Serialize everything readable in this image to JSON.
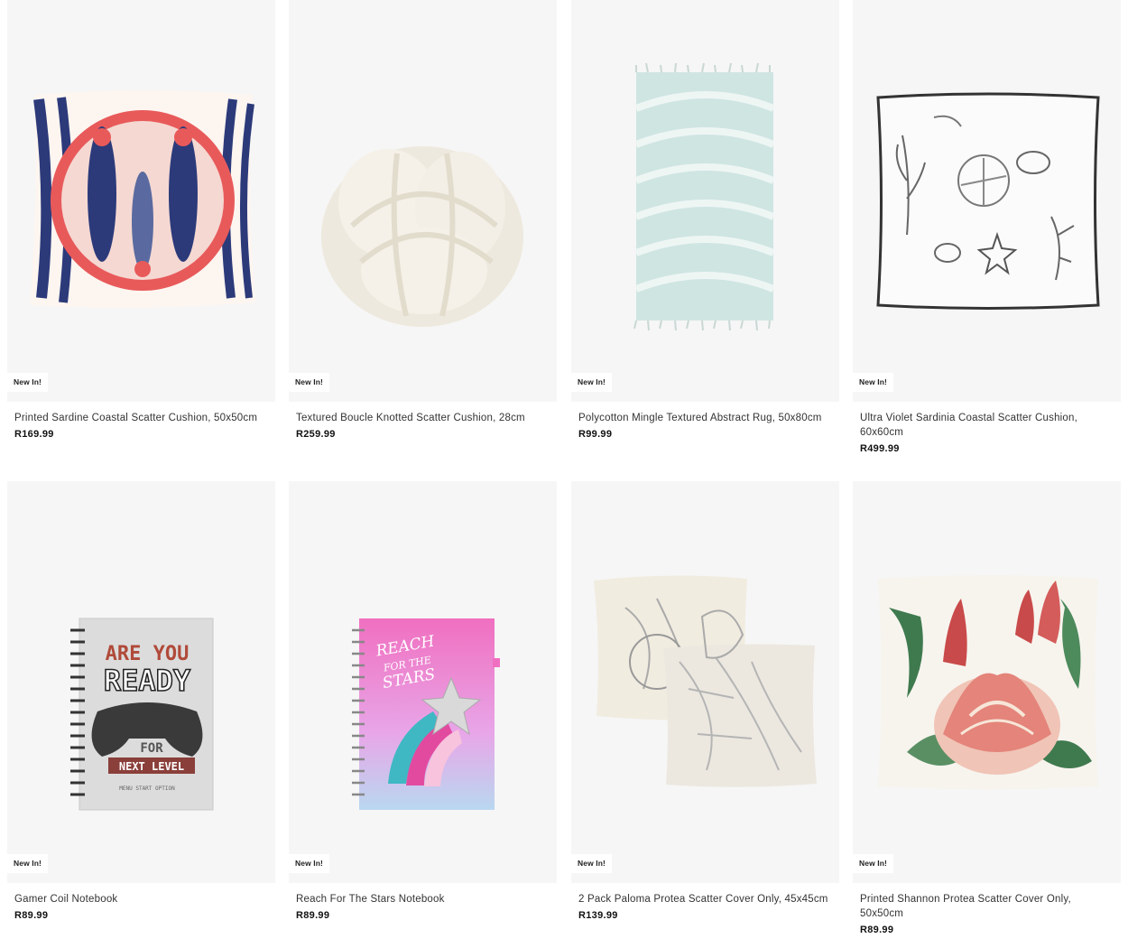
{
  "products": [
    {
      "image": "sardine-cushion",
      "badge": "New In!",
      "title": "Printed Sardine Coastal Scatter Cushion, 50x50cm",
      "price": "R169.99"
    },
    {
      "image": "boucle-knot-cushion",
      "badge": "New In!",
      "title": "Textured Boucle Knotted Scatter Cushion, 28cm",
      "price": "R259.99"
    },
    {
      "image": "abstract-rug",
      "badge": "New In!",
      "title": "Polycotton Mingle Textured Abstract Rug, 50x80cm",
      "price": "R99.99"
    },
    {
      "image": "coastal-cushion",
      "badge": "New In!",
      "title": "Ultra Violet Sardinia Coastal Scatter Cushion, 60x60cm",
      "price": "R499.99"
    },
    {
      "image": "gamer-notebook",
      "badge": "New In!",
      "title": "Gamer Coil Notebook",
      "price": "R89.99",
      "image_text": [
        "ARE YOU",
        "READY",
        "FOR",
        "NEXT LEVEL",
        "MENU START OPTION"
      ]
    },
    {
      "image": "stars-notebook",
      "badge": "New In!",
      "title": "Reach For The Stars Notebook",
      "price": "R89.99",
      "image_text": [
        "REACH",
        "FOR THE",
        "STARS"
      ]
    },
    {
      "image": "protea-cover-pack",
      "badge": "New In!",
      "title": "2 Pack Paloma Protea Scatter Cover Only, 45x45cm",
      "price": "R139.99"
    },
    {
      "image": "protea-cover",
      "badge": "New In!",
      "title": "Printed Shannon Protea Scatter Cover Only, 50x50cm",
      "price": "R89.99"
    }
  ]
}
